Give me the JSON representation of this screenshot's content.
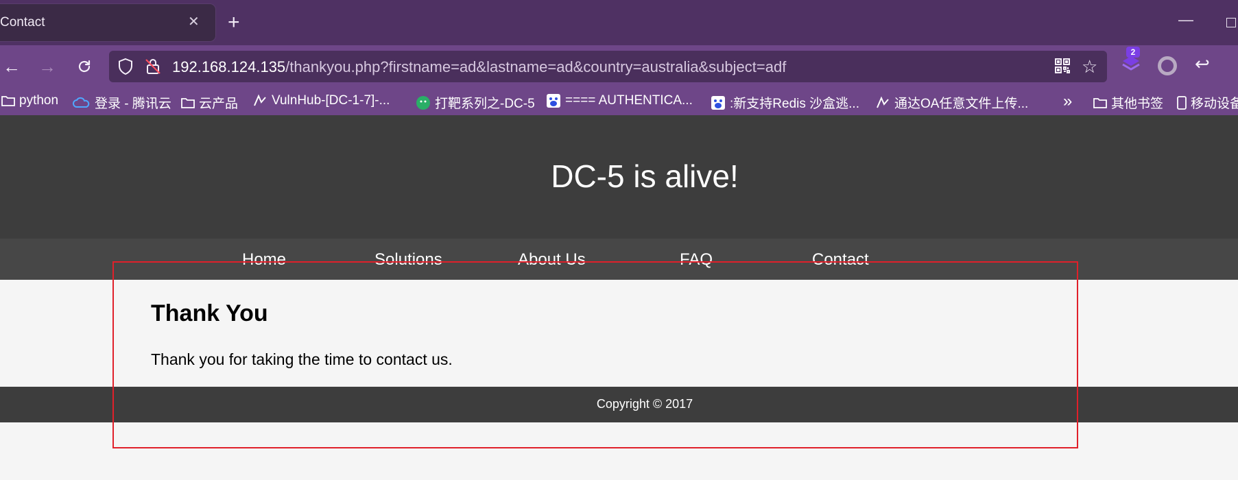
{
  "browser": {
    "tab": {
      "title": "Contact",
      "close_label": "✕"
    },
    "new_tab_label": "+",
    "url": {
      "host": "192.168.124.135",
      "path": "/thankyou.php?firstname=ad&lastname=ad&country=australia&subject=adf"
    },
    "extension_badge": "2",
    "bookmarks": [
      {
        "label": "python",
        "icon": "folder-icon"
      },
      {
        "label": "登录 - 腾讯云",
        "icon": "cloud-icon"
      },
      {
        "label": "云产品",
        "icon": "folder-icon"
      },
      {
        "label": "VulnHub-[DC-1-7]-...",
        "icon": "csdn-icon"
      },
      {
        "label": "打靶系列之-DC-5",
        "icon": "wechat-icon"
      },
      {
        "label": "==== AUTHENTICA...",
        "icon": "baidu-icon"
      },
      {
        "label": ":新支持Redis 沙盒逃...",
        "icon": "baidu-icon"
      },
      {
        "label": "通达OA任意文件上传...",
        "icon": "csdn-icon"
      }
    ],
    "bookmarks_more_label": "»",
    "other_bookmarks": "其他书签",
    "mobile_bookmarks": "移动设备"
  },
  "site": {
    "title": "DC-5 is alive!",
    "nav": [
      "Home",
      "Solutions",
      "About Us",
      "FAQ",
      "Contact"
    ],
    "heading": "Thank You",
    "message": "Thank you for taking the time to contact us.",
    "footer": "Copyright © 2017"
  },
  "colors": {
    "tabstrip": "#4f3163",
    "toolbar": "#6e4688",
    "site_header": "#3d3d3d",
    "annotation": "#e0202a"
  }
}
